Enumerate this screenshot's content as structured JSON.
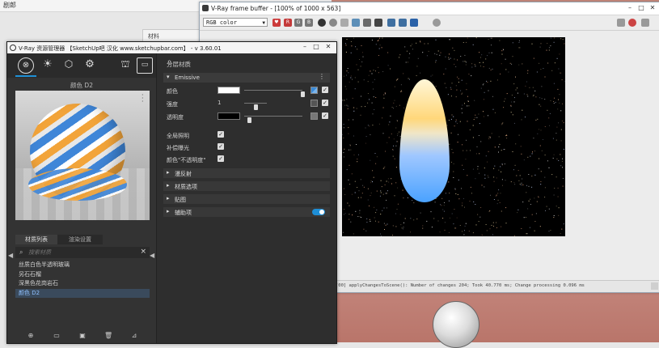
{
  "desktop": {
    "top_title": "剧郎"
  },
  "material_window": {
    "title": "材料"
  },
  "frame_buffer": {
    "title": "V-Ray frame buffer - [100% of 1000 x 563]",
    "channel": "RGB color",
    "toolbar_letters": [
      "R",
      "G",
      "B"
    ],
    "log": "[00] applyChangesToScene(): Number of changes 204; Took 40.770 ms; Change processing 0.096 ms"
  },
  "asset_editor": {
    "title": "V-Ray 资源管理器 【SketchUp吧 汉化 www.sketchupbar.com】 - v 3.60.01",
    "preview_title": "颜色 D2",
    "library_tabs": [
      "材质列表",
      "渲染设置"
    ],
    "search_placeholder": "搜索材质",
    "materials": [
      "丝质白色半透明玻璃",
      "另石石榴",
      "深黑色花岗岩石",
      "颜色 D2"
    ],
    "selected_material_index": 3,
    "layer_header": "分层材质",
    "emissive_label": "Emissive",
    "props": {
      "color_label": "颜色",
      "intensity_label": "强度",
      "intensity_value": "1",
      "opacity_label": "透明度",
      "gi_label": "全局照明",
      "compensate_label": "补偿曝光",
      "direct_label": "颜色\"不透明度\""
    },
    "sections": [
      "漫反射",
      "材质选项",
      "贴图",
      "辅助项"
    ],
    "colors": {
      "color_swatch": "#ffffff",
      "opacity_swatch": "#000000",
      "accent": "#1e8ed6"
    }
  }
}
